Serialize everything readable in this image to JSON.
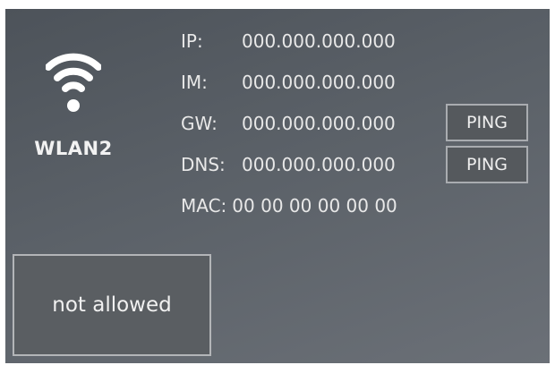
{
  "interface": {
    "name": "WLAN2",
    "icon": "wifi-icon"
  },
  "info": {
    "ip": {
      "label": "IP:",
      "value": "000.000.000.000"
    },
    "im": {
      "label": "IM:",
      "value": "000.000.000.000"
    },
    "gw": {
      "label": "GW:",
      "value": "000.000.000.000"
    },
    "dns": {
      "label": "DNS:",
      "value": "000.000.000.000"
    },
    "mac": {
      "label": "MAC:",
      "value": "00 00 00 00 00 00"
    }
  },
  "buttons": {
    "ping_gw": "PING",
    "ping_dns": "PING",
    "status": "not allowed"
  },
  "colors": {
    "panel_start": "#4d535a",
    "panel_end": "#6b7077",
    "button_bg": "#55595d",
    "button_border": "#a9acb0",
    "text": "#e8e8e8"
  }
}
